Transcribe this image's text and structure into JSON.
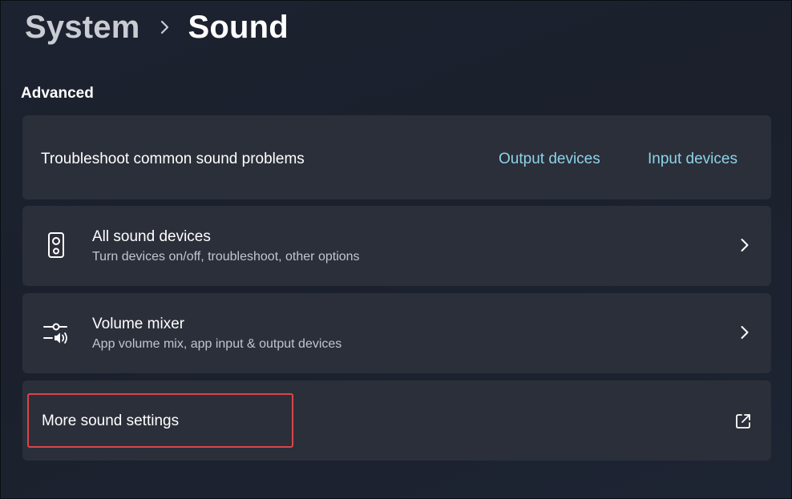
{
  "breadcrumb": {
    "parent": "System",
    "separator": ">",
    "current": "Sound"
  },
  "section": {
    "title": "Advanced"
  },
  "troubleshoot": {
    "label": "Troubleshoot common sound problems",
    "links": [
      "Output devices",
      "Input devices"
    ]
  },
  "rows": [
    {
      "icon": "speaker-icon",
      "title": "All sound devices",
      "subtitle": "Turn devices on/off, troubleshoot, other options",
      "action_icon": "chevron-right-icon"
    },
    {
      "icon": "volume-mixer-icon",
      "title": "Volume mixer",
      "subtitle": "App volume mix, app input & output devices",
      "action_icon": "chevron-right-icon"
    }
  ],
  "more": {
    "label": "More sound settings",
    "action_icon": "open-external-icon"
  },
  "colors": {
    "background": "#1c2230",
    "card": "#2b2f3a",
    "link": "#8cd3e8",
    "highlight": "#d7464a"
  }
}
